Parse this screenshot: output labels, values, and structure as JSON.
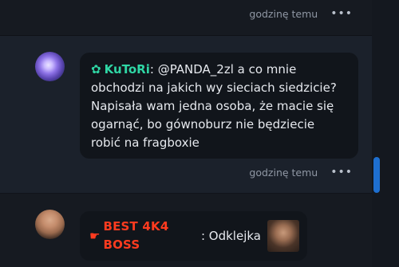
{
  "messages": [
    {
      "time": "godzinę temu",
      "more_icon": "more-horizontal-icon"
    },
    {
      "avatar_icon": "galaxy-avatar",
      "badge_icon": "gear-icon",
      "nickname": "KuToRi",
      "text": "@PANDA_2zl a co mnie obchodzi na jakich wy sieciach siedzicie? Napisała wam jedna osoba, że macie się ogarnąć, bo gównoburz nie będziecie robić na fragboxie",
      "time": "godzinę temu",
      "more_icon": "more-horizontal-icon"
    },
    {
      "avatar_icon": "person-avatar",
      "badge_icon": "pointing-hand-icon",
      "nickname": "BEST 4K4 BOSS",
      "text": "Odklejka",
      "emote_icon": "face-emote"
    }
  ],
  "colors": {
    "nick_teal": "#2fd7a5",
    "nick_red": "#ff3b1f",
    "scroll_accent": "#1e6fd0"
  }
}
